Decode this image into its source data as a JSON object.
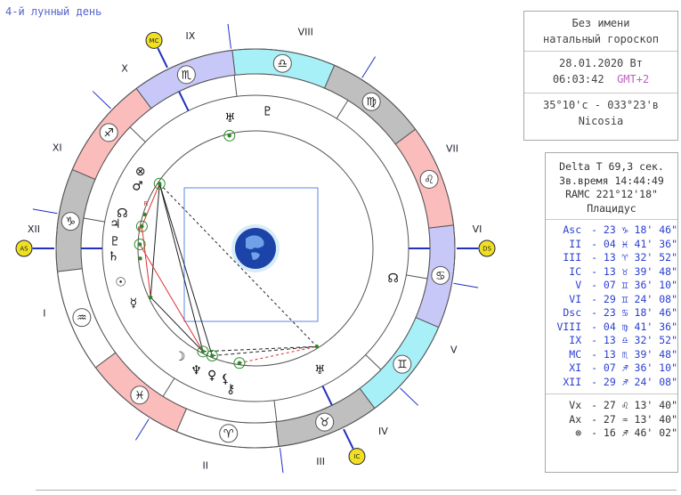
{
  "moon_day": "4-й лунный день",
  "info": {
    "name": "Без имени",
    "chart_type": "натальный гороскоп",
    "date": "28.01.2020 Вт",
    "time": "06:03:42",
    "gmt": "GMT+2",
    "coords": "35°10'с - 033°23'в",
    "city": "Nicosia"
  },
  "params": {
    "delta_t": "Delta T  69,3 сек.",
    "sidereal": "Зв.время 14:44:49",
    "ramc": "RAMC 221°12'18\"",
    "system": "Плацидус"
  },
  "cusps": [
    {
      "label": "Asc",
      "sign": "♑",
      "value": "23 ♑ 18' 46\""
    },
    {
      "label": "II",
      "sign": "♓",
      "value": "04 ♓ 41' 36\""
    },
    {
      "label": "III",
      "sign": "♈",
      "value": "13 ♈ 32' 52\""
    },
    {
      "label": "IC",
      "sign": "♉",
      "value": "13 ♉ 39' 48\""
    },
    {
      "label": "V",
      "sign": "♊",
      "value": "07 ♊ 36' 10\""
    },
    {
      "label": "VI",
      "sign": "♊",
      "value": "29 ♊ 24' 08\""
    },
    {
      "label": "Dsc",
      "sign": "♋",
      "value": "23 ♋ 18' 46\""
    },
    {
      "label": "VIII",
      "sign": "♍",
      "value": "04 ♍ 41' 36\""
    },
    {
      "label": "IX",
      "sign": "♎",
      "value": "13 ♎ 32' 52\""
    },
    {
      "label": "MC",
      "sign": "♏",
      "value": "13 ♏ 39' 48\""
    },
    {
      "label": "XI",
      "sign": "♐",
      "value": "07 ♐ 36' 10\""
    },
    {
      "label": "XII",
      "sign": "♐",
      "value": "29 ♐ 24' 08\""
    }
  ],
  "points": [
    {
      "label": "Vx",
      "value": "27 ♌ 13' 40\""
    },
    {
      "label": "Ax",
      "value": "27 ♒ 13' 40\""
    },
    {
      "label": "⊗",
      "value": "16 ♐ 46' 02\""
    }
  ],
  "chart": {
    "house_numerals": [
      "I",
      "II",
      "III",
      "IV",
      "V",
      "VI",
      "VII",
      "VIII",
      "IX",
      "X",
      "XI",
      "XII"
    ],
    "angle_badges": {
      "asc": "AS",
      "dsc": "DS",
      "mc": "MC",
      "ic": "IC"
    },
    "signs": [
      {
        "glyph": "♑",
        "fill": "#bfbfbf"
      },
      {
        "glyph": "♒",
        "fill": "#ffffff"
      },
      {
        "glyph": "♓",
        "fill": "#fbbcbc"
      },
      {
        "glyph": "♈",
        "fill": "#ffffff"
      },
      {
        "glyph": "♉",
        "fill": "#bfbfbf"
      },
      {
        "glyph": "♊",
        "fill": "#a8f0f8"
      },
      {
        "glyph": "♋",
        "fill": "#c8c8f8"
      },
      {
        "glyph": "♌",
        "fill": "#fbbcbc"
      },
      {
        "glyph": "♍",
        "fill": "#bfbfbf"
      },
      {
        "glyph": "♎",
        "fill": "#a8f0f8"
      },
      {
        "glyph": "♏",
        "fill": "#c8c8f8"
      },
      {
        "glyph": "♐",
        "fill": "#fbbcbc"
      }
    ],
    "planets": [
      {
        "glyph": "♂",
        "name": "mars"
      },
      {
        "glyph": "⊗",
        "name": "fortune"
      },
      {
        "glyph": "☊",
        "name": "node"
      },
      {
        "glyph": "♃",
        "name": "jupiter"
      },
      {
        "glyph": "♇",
        "name": "pluto"
      },
      {
        "glyph": "♄",
        "name": "saturn"
      },
      {
        "glyph": "☉",
        "name": "sun"
      },
      {
        "glyph": "☿",
        "name": "mercury"
      },
      {
        "glyph": "☽",
        "name": "moon"
      },
      {
        "glyph": "♆",
        "name": "neptune"
      },
      {
        "glyph": "♀",
        "name": "venus"
      },
      {
        "glyph": "⚸",
        "name": "lilith"
      },
      {
        "glyph": "⚷",
        "name": "chiron"
      },
      {
        "glyph": "♅",
        "name": "uranus-r"
      },
      {
        "glyph": "♅",
        "name": "uranus"
      },
      {
        "glyph": "♇",
        "name": "pluto-top"
      },
      {
        "glyph": "☊",
        "name": "south-node"
      }
    ],
    "retro_mark": "R",
    "colors": {
      "aspect_red": "#e03030",
      "aspect_black": "#222222",
      "cusp_blue": "#2030c0",
      "badge_yellow": "#f0e020"
    }
  }
}
